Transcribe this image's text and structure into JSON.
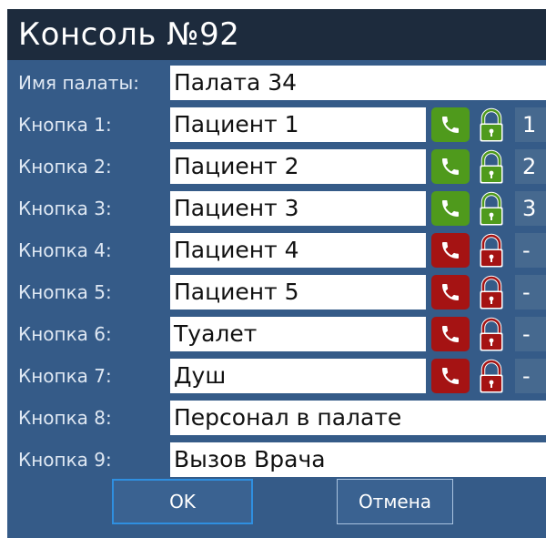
{
  "title": "Консоль №92",
  "room": {
    "label": "Имя палаты:",
    "value": "Палата 34"
  },
  "buttons": [
    {
      "label": "Кнопка 1:",
      "value": "Пациент 1",
      "call_state": "green",
      "lock_state": "green",
      "number": "1"
    },
    {
      "label": "Кнопка 2:",
      "value": "Пациент 2",
      "call_state": "green",
      "lock_state": "green",
      "number": "2"
    },
    {
      "label": "Кнопка 3:",
      "value": "Пациент 3",
      "call_state": "green",
      "lock_state": "green",
      "number": "3"
    },
    {
      "label": "Кнопка 4:",
      "value": "Пациент 4",
      "call_state": "red",
      "lock_state": "red",
      "number": "-"
    },
    {
      "label": "Кнопка 5:",
      "value": "Пациент 5",
      "call_state": "red",
      "lock_state": "red",
      "number": "-"
    },
    {
      "label": "Кнопка 6:",
      "value": "Туалет",
      "call_state": "red",
      "lock_state": "red",
      "number": "-"
    },
    {
      "label": "Кнопка 7:",
      "value": "Душ",
      "call_state": "red",
      "lock_state": "red",
      "number": "-"
    },
    {
      "label": "Кнопка 8:",
      "value": "Персонал в палате"
    },
    {
      "label": "Кнопка 9:",
      "value": "Вызов Врача"
    }
  ],
  "footer": {
    "ok_label": "OK",
    "cancel_label": "Отмена"
  },
  "colors": {
    "panel": "#355b88",
    "titlebar": "#1d2b3d",
    "green": "#4f9a1c",
    "red": "#a51313"
  },
  "icons": {
    "call": "phone-handset-icon",
    "lock": "padlock-icon"
  }
}
